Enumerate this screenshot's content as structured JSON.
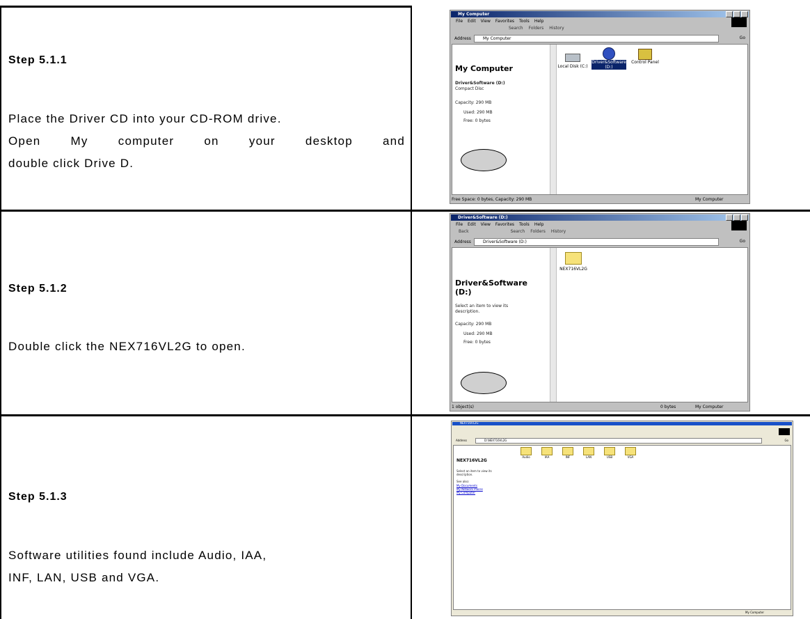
{
  "steps": [
    {
      "title": "Step 5.1.1",
      "body_lines": [
        "Place the Driver CD into your CD-ROM drive.",
        "Open My computer on your desktop and",
        "double click Drive D."
      ],
      "screenshot": {
        "window_title": "My Computer",
        "menu": [
          "File",
          "Edit",
          "View",
          "Favorites",
          "Tools",
          "Help"
        ],
        "toolbar": [
          "Search",
          "Folders",
          "History"
        ],
        "address_label": "Address",
        "address_value": "My Computer",
        "go_label": "Go",
        "pane_title": "My Computer",
        "pane_lines": [
          "Driver&Software (D:)",
          "Compact Disc",
          "",
          "Capacity: 290 MB",
          "Used: 290 MB",
          "Free: 0 bytes"
        ],
        "items": [
          "Local Disk (C:)",
          "Driver&Software (D:)",
          "Control Panel"
        ],
        "status_left": "Free Space: 0 bytes, Capacity: 290 MB",
        "status_right": "My Computer"
      }
    },
    {
      "title": "Step 5.1.2",
      "body_lines": [
        "Double click the NEX716VL2G to open."
      ],
      "screenshot": {
        "window_title": "Driver&Software (D:)",
        "menu": [
          "File",
          "Edit",
          "View",
          "Favorites",
          "Tools",
          "Help"
        ],
        "toolbar": [
          "Back",
          "Search",
          "Folders",
          "History"
        ],
        "address_label": "Address",
        "address_value": "Driver&Software (D:)",
        "go_label": "Go",
        "pane_title": "Driver&Software (D:)",
        "pane_lines": [
          "Select an item to view its",
          "description.",
          "",
          "Capacity: 290 MB",
          "Used: 290 MB",
          "Free: 0 bytes"
        ],
        "items": [
          "NEX716VL2G"
        ],
        "status_left": "1 object(s)",
        "status_mid": "0 bytes",
        "status_right": "My Computer"
      }
    },
    {
      "title": "Step 5.1.3",
      "body_lines": [
        "Software utilities found include Audio, IAA,",
        "INF, LAN, USB and VGA."
      ],
      "screenshot": {
        "window_title": "NEX716VL2G",
        "address_label": "Address",
        "address_value": "D:\\NEX716VL2G",
        "go_label": "Go",
        "pane_title": "NEX716VL2G",
        "pane_lines": [
          "Select an item to view its",
          "description.",
          "",
          "See also:"
        ],
        "links": [
          "My Documents",
          "My Network Places",
          "My Computer"
        ],
        "items": [
          "Audio",
          "IAA",
          "INF",
          "LAN",
          "USB",
          "VGA"
        ],
        "status_right": "My Computer"
      }
    }
  ]
}
